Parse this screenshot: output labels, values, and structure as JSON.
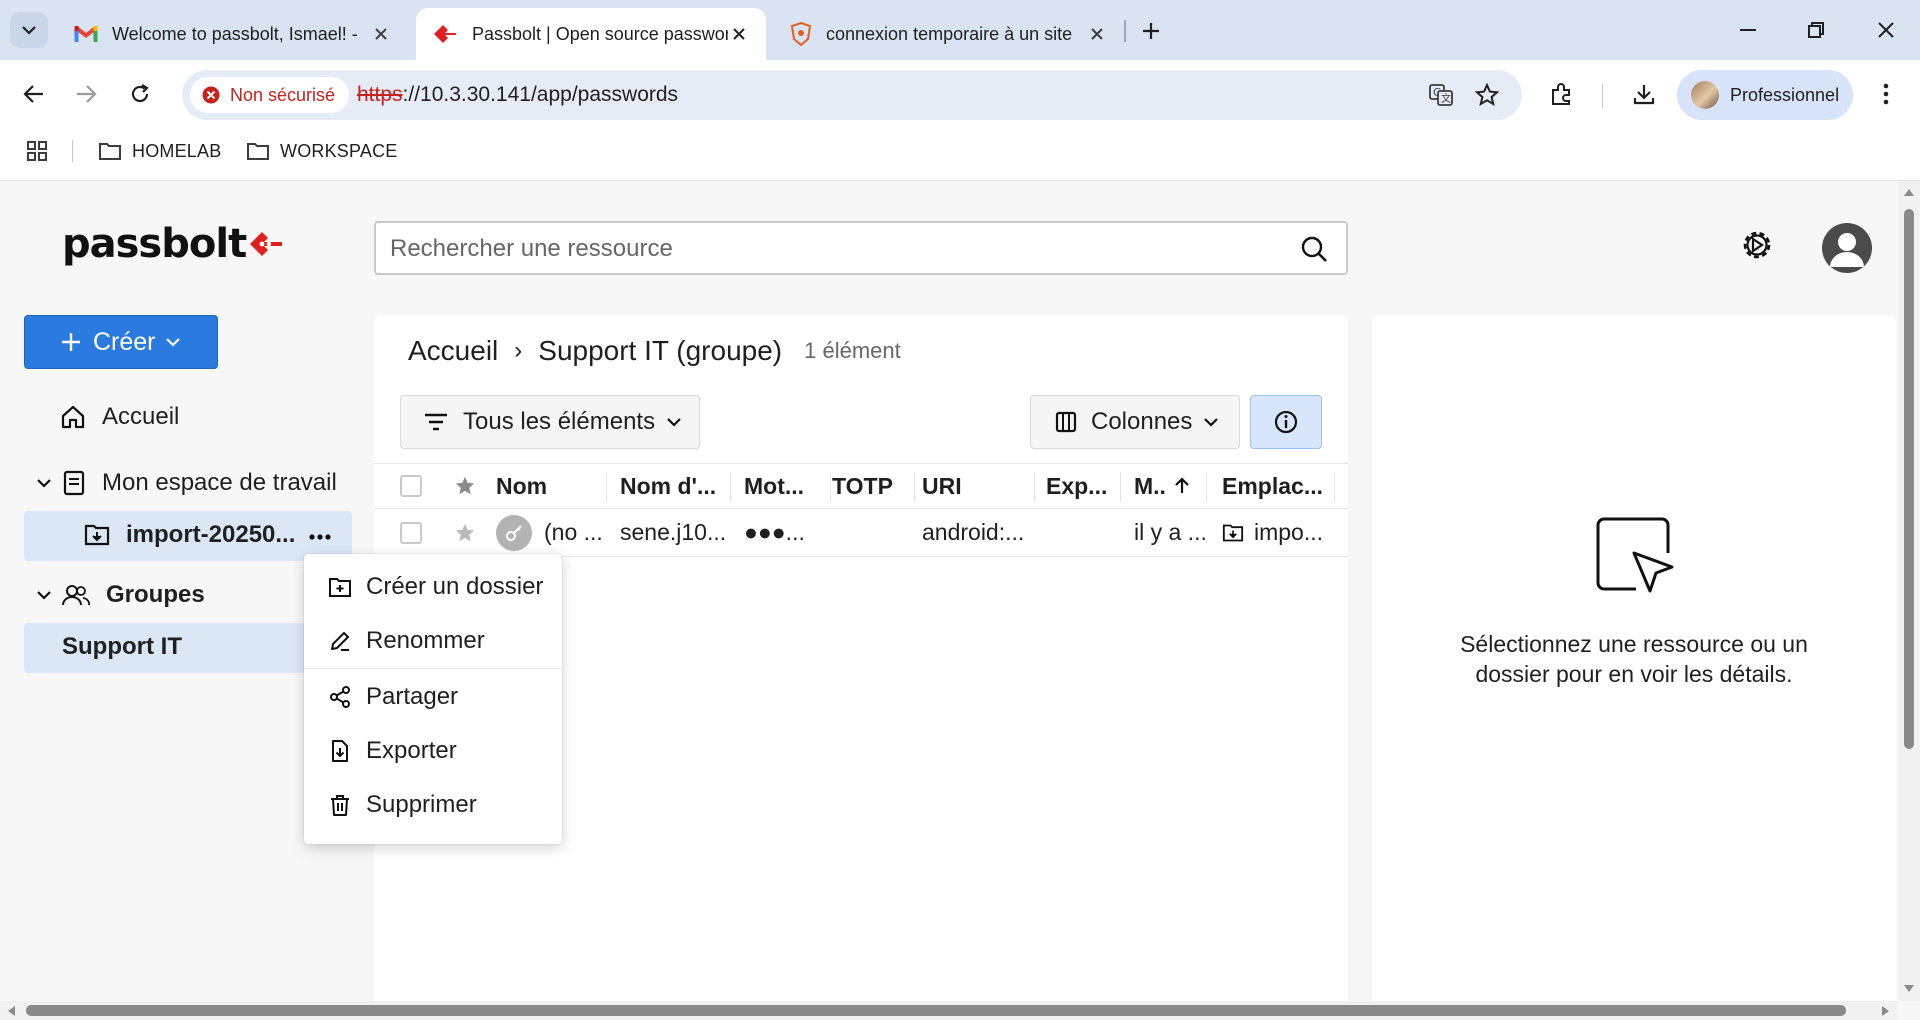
{
  "browser": {
    "tabs": [
      {
        "title": "Welcome to passbolt, Ismael! -",
        "icon": "gmail-icon",
        "active": false
      },
      {
        "title": "Passbolt | Open source passwor",
        "icon": "passbolt-favicon",
        "active": true
      },
      {
        "title": "connexion temporaire à un site",
        "icon": "brave-shield-icon",
        "active": false
      }
    ],
    "security_label": "Non sécurisé",
    "url_scheme": "https",
    "url_rest": "://10.3.30.141/app/passwords",
    "profile_label": "Professionnel",
    "bookmarks": [
      {
        "label": "HOMELAB",
        "icon": "folder-icon"
      },
      {
        "label": "WORKSPACE",
        "icon": "folder-icon"
      }
    ]
  },
  "app": {
    "logo_text": "passbolt",
    "search_placeholder": "Rechercher une ressource",
    "create_label": "Créer",
    "sidebar": {
      "home_label": "Accueil",
      "workspace_label": "Mon espace de travail",
      "folder_label": "import-20250...",
      "groups_label": "Groupes",
      "group_item_label": "Support IT"
    },
    "breadcrumb": {
      "root": "Accueil",
      "separator": "›",
      "current": "Support IT (groupe)",
      "count": "1 élément"
    },
    "filter_label": "Tous les éléments",
    "columns_label": "Colonnes",
    "grid": {
      "columns": [
        "Nom",
        "Nom d'...",
        "Mot...",
        "TOTP",
        "URI",
        "Exp...",
        "M..",
        "Emplac..."
      ],
      "rows": [
        {
          "name": "(no ...",
          "username": "sene.j10...",
          "password": "●●●...",
          "totp": "",
          "uri": "android:...",
          "expiry": "",
          "modified": "il y a ...",
          "location": "impo..."
        }
      ]
    },
    "details_text": "Sélectionnez une ressource ou un dossier pour en voir les détails.",
    "context_menu": [
      {
        "label": "Créer un dossier",
        "icon": "folder-plus-icon"
      },
      {
        "label": "Renommer",
        "icon": "pencil-icon"
      },
      {
        "label": "Partager",
        "icon": "share-icon"
      },
      {
        "label": "Exporter",
        "icon": "export-icon"
      },
      {
        "label": "Supprimer",
        "icon": "trash-icon"
      }
    ],
    "colors": {
      "primary": "#2a7adf",
      "selected_bg": "#dce7f6",
      "insecure_red": "#c5221f",
      "logo_red": "#e0201e"
    }
  }
}
